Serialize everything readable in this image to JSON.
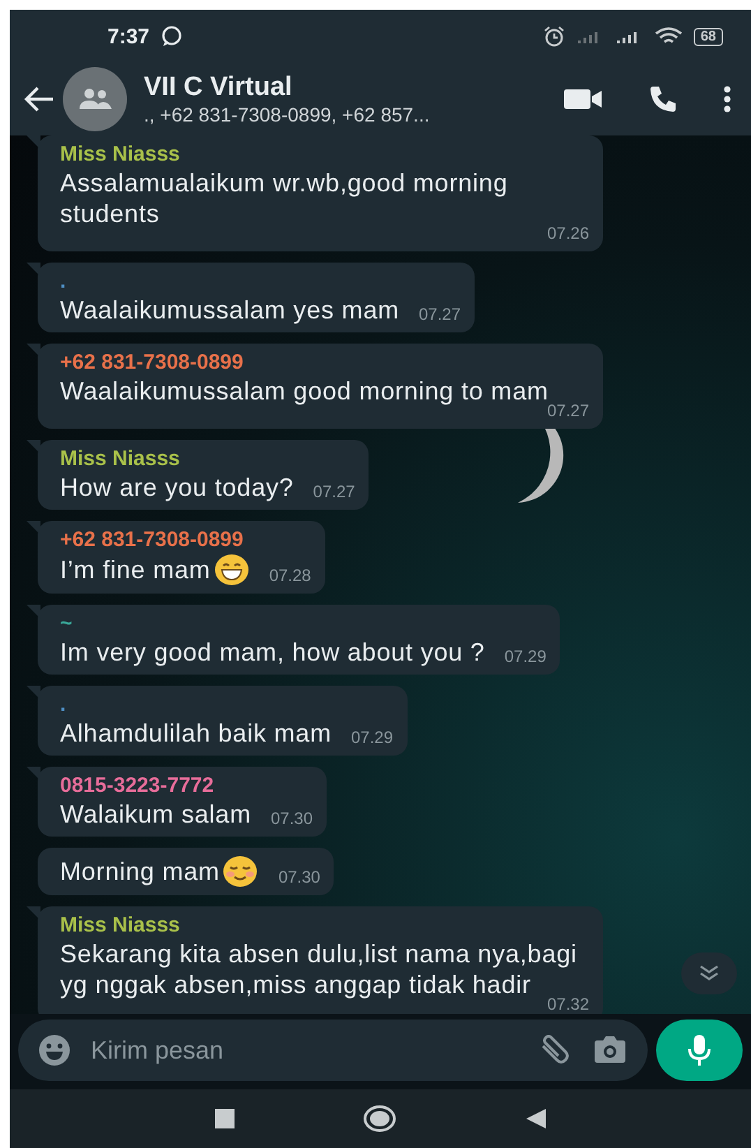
{
  "status_bar": {
    "time": "7:37",
    "battery": "68"
  },
  "header": {
    "title": "VII C Virtual",
    "subtitle": "., +62 831-7308-0899, +62 857..."
  },
  "messages": [
    {
      "sender": "Miss Niasss",
      "color": "#a9c14a",
      "text": "Assalamualaikum wr.wb,good morning students",
      "time": "07.26",
      "tail": true
    },
    {
      "sender": ".",
      "color": "#4f8fc4",
      "text": "Waalaikumussalam yes mam",
      "time": "07.27",
      "tail": true
    },
    {
      "sender": "+62 831-7308-0899",
      "color": "#e8714a",
      "text": "Waalaikumussalam good morning to mam",
      "time": "07.27",
      "tail": true
    },
    {
      "sender": "Miss Niasss",
      "color": "#a9c14a",
      "text": "How are you today?",
      "time": "07.27",
      "tail": true
    },
    {
      "sender": "+62 831-7308-0899",
      "color": "#e8714a",
      "text": "I’m fine mam",
      "kind": "grin",
      "time": "07.28",
      "tail": true
    },
    {
      "sender": "~",
      "color": "#3aa99a",
      "text": "Im very good mam, how about you ?",
      "time": "07.29",
      "tail": true
    },
    {
      "sender": ".",
      "color": "#4f8fc4",
      "text": "Alhamdulilah baik mam",
      "time": "07.29",
      "tail": true
    },
    {
      "sender": "0815-3223-7772",
      "color": "#e86d9a",
      "text": "Walaikum salam",
      "time": "07.30",
      "tail": true
    },
    {
      "text": "Morning mam",
      "kind": "smile",
      "time": "07.30",
      "tail": false
    },
    {
      "sender": "Miss Niasss",
      "color": "#a9c14a",
      "text": "Sekarang kita absen dulu,list nama nya,bagi yg nggak absen,miss anggap tidak hadir",
      "time": "07.32",
      "tail": true
    }
  ],
  "composer": {
    "placeholder": "Kirim pesan"
  }
}
